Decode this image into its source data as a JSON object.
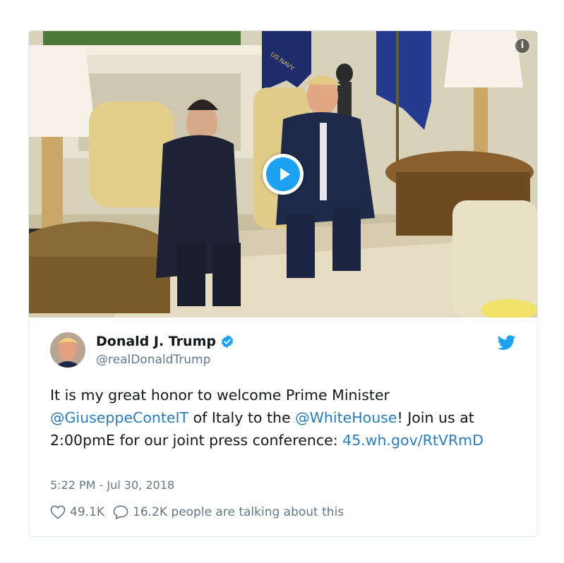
{
  "media": {
    "flag_text": "US NAVY",
    "play_icon": "play-icon",
    "info_icon": "info-icon"
  },
  "tweet": {
    "author_name": "Donald J. Trump",
    "handle": "@realDonaldTrump",
    "text_part1": "It is my great honor to welcome Prime Minister ",
    "mention_1": "@GiuseppeConteIT",
    "text_part2": " of Italy to the ",
    "mention_2": "@WhiteHouse",
    "text_part3": "! Join us at 2:00pmE for our joint press conference: ",
    "link": "45.wh.gov/RtVRmD",
    "timestamp": "5:22 PM - Jul 30, 2018",
    "likes": "49.1K",
    "talking": "16.2K people are talking about this"
  },
  "colors": {
    "link": "#2b7bb9",
    "brand": "#1da1f2",
    "muted": "#657786",
    "text": "#14171a"
  }
}
